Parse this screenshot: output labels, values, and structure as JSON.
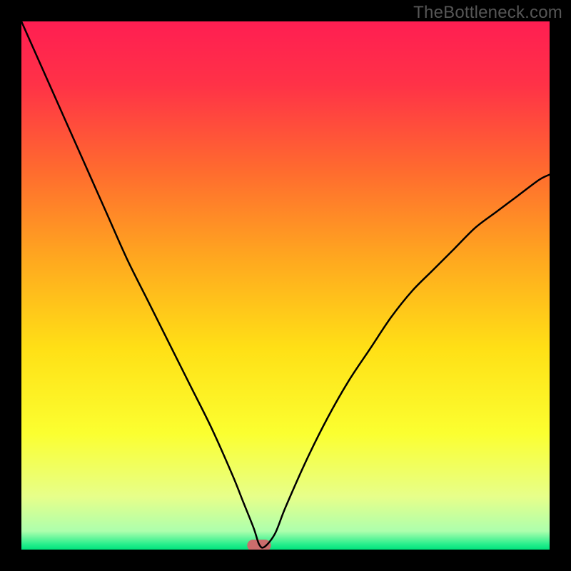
{
  "watermark": "TheBottleneck.com",
  "chart_data": {
    "type": "line",
    "title": "",
    "xlabel": "",
    "ylabel": "",
    "xlim": [
      0,
      100
    ],
    "ylim": [
      0,
      100
    ],
    "grid": false,
    "legend": false,
    "background_gradient": [
      {
        "pos": 0.0,
        "color": "#ff1e52"
      },
      {
        "pos": 0.12,
        "color": "#ff3247"
      },
      {
        "pos": 0.28,
        "color": "#ff6a2f"
      },
      {
        "pos": 0.45,
        "color": "#ffa81f"
      },
      {
        "pos": 0.62,
        "color": "#ffe016"
      },
      {
        "pos": 0.78,
        "color": "#fbff30"
      },
      {
        "pos": 0.9,
        "color": "#e7ff8a"
      },
      {
        "pos": 0.965,
        "color": "#adffad"
      },
      {
        "pos": 0.99,
        "color": "#26ee8c"
      },
      {
        "pos": 1.0,
        "color": "#00e27c"
      }
    ],
    "series": [
      {
        "name": "bottleneck-curve",
        "color": "#000000",
        "x": [
          0,
          4,
          8,
          12,
          16,
          20,
          24,
          28,
          32,
          36,
          40,
          42,
          44,
          45,
          46,
          48,
          50,
          54,
          58,
          62,
          66,
          70,
          74,
          78,
          82,
          86,
          90,
          94,
          98,
          100
        ],
        "y": [
          100,
          91,
          82,
          73,
          64,
          55,
          47,
          39,
          31,
          23,
          14,
          9,
          4,
          1,
          0.5,
          3,
          8,
          17,
          25,
          32,
          38,
          44,
          49,
          53,
          57,
          61,
          64,
          67,
          70,
          71
        ]
      }
    ],
    "minimum_marker": {
      "x": 45,
      "y": 0.8,
      "width_x": 4.5,
      "height_y": 2.2,
      "color": "#cb6c6c"
    }
  }
}
